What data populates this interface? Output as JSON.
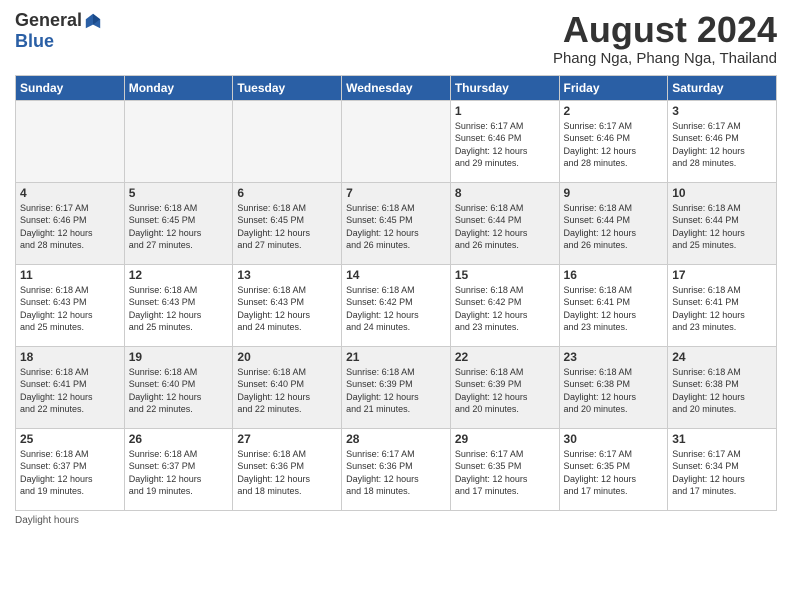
{
  "logo": {
    "general": "General",
    "blue": "Blue"
  },
  "title": "August 2024",
  "location": "Phang Nga, Phang Nga, Thailand",
  "days_of_week": [
    "Sunday",
    "Monday",
    "Tuesday",
    "Wednesday",
    "Thursday",
    "Friday",
    "Saturday"
  ],
  "footer": "Daylight hours",
  "weeks": [
    [
      {
        "day": "",
        "info": ""
      },
      {
        "day": "",
        "info": ""
      },
      {
        "day": "",
        "info": ""
      },
      {
        "day": "",
        "info": ""
      },
      {
        "day": "1",
        "info": "Sunrise: 6:17 AM\nSunset: 6:46 PM\nDaylight: 12 hours\nand 29 minutes."
      },
      {
        "day": "2",
        "info": "Sunrise: 6:17 AM\nSunset: 6:46 PM\nDaylight: 12 hours\nand 28 minutes."
      },
      {
        "day": "3",
        "info": "Sunrise: 6:17 AM\nSunset: 6:46 PM\nDaylight: 12 hours\nand 28 minutes."
      }
    ],
    [
      {
        "day": "4",
        "info": "Sunrise: 6:17 AM\nSunset: 6:46 PM\nDaylight: 12 hours\nand 28 minutes."
      },
      {
        "day": "5",
        "info": "Sunrise: 6:18 AM\nSunset: 6:45 PM\nDaylight: 12 hours\nand 27 minutes."
      },
      {
        "day": "6",
        "info": "Sunrise: 6:18 AM\nSunset: 6:45 PM\nDaylight: 12 hours\nand 27 minutes."
      },
      {
        "day": "7",
        "info": "Sunrise: 6:18 AM\nSunset: 6:45 PM\nDaylight: 12 hours\nand 26 minutes."
      },
      {
        "day": "8",
        "info": "Sunrise: 6:18 AM\nSunset: 6:44 PM\nDaylight: 12 hours\nand 26 minutes."
      },
      {
        "day": "9",
        "info": "Sunrise: 6:18 AM\nSunset: 6:44 PM\nDaylight: 12 hours\nand 26 minutes."
      },
      {
        "day": "10",
        "info": "Sunrise: 6:18 AM\nSunset: 6:44 PM\nDaylight: 12 hours\nand 25 minutes."
      }
    ],
    [
      {
        "day": "11",
        "info": "Sunrise: 6:18 AM\nSunset: 6:43 PM\nDaylight: 12 hours\nand 25 minutes."
      },
      {
        "day": "12",
        "info": "Sunrise: 6:18 AM\nSunset: 6:43 PM\nDaylight: 12 hours\nand 25 minutes."
      },
      {
        "day": "13",
        "info": "Sunrise: 6:18 AM\nSunset: 6:43 PM\nDaylight: 12 hours\nand 24 minutes."
      },
      {
        "day": "14",
        "info": "Sunrise: 6:18 AM\nSunset: 6:42 PM\nDaylight: 12 hours\nand 24 minutes."
      },
      {
        "day": "15",
        "info": "Sunrise: 6:18 AM\nSunset: 6:42 PM\nDaylight: 12 hours\nand 23 minutes."
      },
      {
        "day": "16",
        "info": "Sunrise: 6:18 AM\nSunset: 6:41 PM\nDaylight: 12 hours\nand 23 minutes."
      },
      {
        "day": "17",
        "info": "Sunrise: 6:18 AM\nSunset: 6:41 PM\nDaylight: 12 hours\nand 23 minutes."
      }
    ],
    [
      {
        "day": "18",
        "info": "Sunrise: 6:18 AM\nSunset: 6:41 PM\nDaylight: 12 hours\nand 22 minutes."
      },
      {
        "day": "19",
        "info": "Sunrise: 6:18 AM\nSunset: 6:40 PM\nDaylight: 12 hours\nand 22 minutes."
      },
      {
        "day": "20",
        "info": "Sunrise: 6:18 AM\nSunset: 6:40 PM\nDaylight: 12 hours\nand 22 minutes."
      },
      {
        "day": "21",
        "info": "Sunrise: 6:18 AM\nSunset: 6:39 PM\nDaylight: 12 hours\nand 21 minutes."
      },
      {
        "day": "22",
        "info": "Sunrise: 6:18 AM\nSunset: 6:39 PM\nDaylight: 12 hours\nand 20 minutes."
      },
      {
        "day": "23",
        "info": "Sunrise: 6:18 AM\nSunset: 6:38 PM\nDaylight: 12 hours\nand 20 minutes."
      },
      {
        "day": "24",
        "info": "Sunrise: 6:18 AM\nSunset: 6:38 PM\nDaylight: 12 hours\nand 20 minutes."
      }
    ],
    [
      {
        "day": "25",
        "info": "Sunrise: 6:18 AM\nSunset: 6:37 PM\nDaylight: 12 hours\nand 19 minutes."
      },
      {
        "day": "26",
        "info": "Sunrise: 6:18 AM\nSunset: 6:37 PM\nDaylight: 12 hours\nand 19 minutes."
      },
      {
        "day": "27",
        "info": "Sunrise: 6:18 AM\nSunset: 6:36 PM\nDaylight: 12 hours\nand 18 minutes."
      },
      {
        "day": "28",
        "info": "Sunrise: 6:17 AM\nSunset: 6:36 PM\nDaylight: 12 hours\nand 18 minutes."
      },
      {
        "day": "29",
        "info": "Sunrise: 6:17 AM\nSunset: 6:35 PM\nDaylight: 12 hours\nand 17 minutes."
      },
      {
        "day": "30",
        "info": "Sunrise: 6:17 AM\nSunset: 6:35 PM\nDaylight: 12 hours\nand 17 minutes."
      },
      {
        "day": "31",
        "info": "Sunrise: 6:17 AM\nSunset: 6:34 PM\nDaylight: 12 hours\nand 17 minutes."
      }
    ]
  ]
}
